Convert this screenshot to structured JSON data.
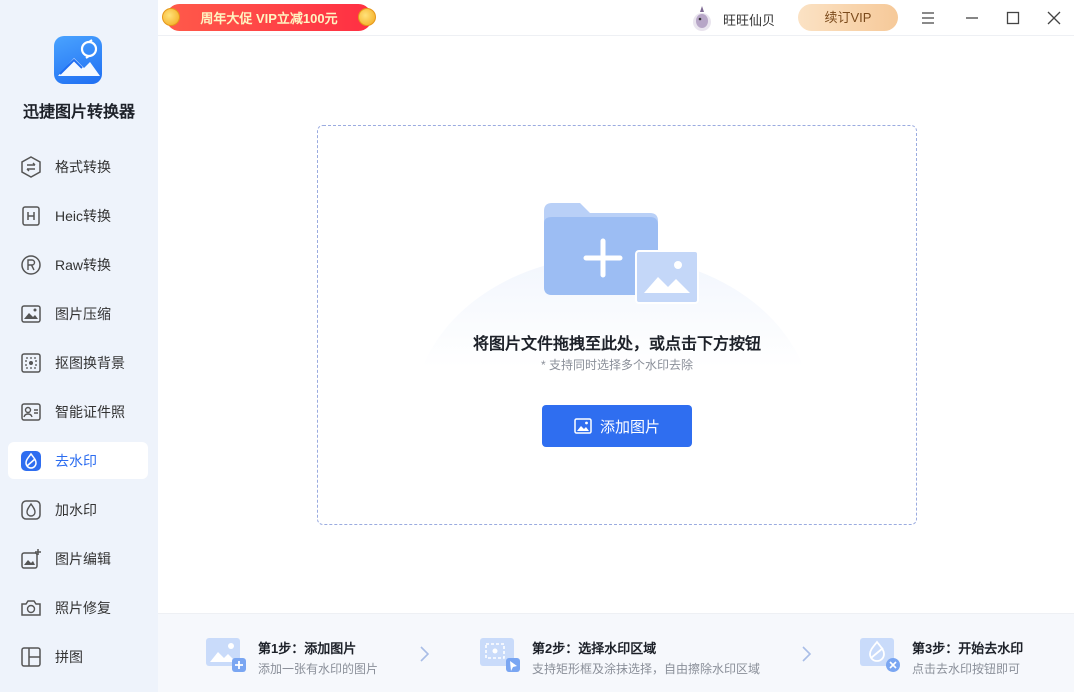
{
  "app": {
    "title": "迅捷图片转换器"
  },
  "sidebar": {
    "items": [
      {
        "label": "格式转换",
        "icon": "format-convert-icon"
      },
      {
        "label": "Heic转换",
        "icon": "heic-icon"
      },
      {
        "label": "Raw转换",
        "icon": "raw-icon"
      },
      {
        "label": "图片压缩",
        "icon": "compress-icon"
      },
      {
        "label": "抠图换背景",
        "icon": "cutout-icon"
      },
      {
        "label": "智能证件照",
        "icon": "id-photo-icon"
      },
      {
        "label": "去水印",
        "icon": "remove-watermark-icon",
        "active": true
      },
      {
        "label": "加水印",
        "icon": "add-watermark-icon"
      },
      {
        "label": "图片编辑",
        "icon": "image-edit-icon"
      },
      {
        "label": "照片修复",
        "icon": "photo-repair-icon"
      },
      {
        "label": "拼图",
        "icon": "collage-icon"
      }
    ]
  },
  "topbar": {
    "promo": "周年大促 VIP立减100元",
    "username": "旺旺仙贝",
    "vip_button": "续订VIP"
  },
  "dropzone": {
    "title": "将图片文件拖拽至此处，或点击下方按钮",
    "subtitle": "* 支持同时选择多个水印去除",
    "button": "添加图片"
  },
  "steps": [
    {
      "title": "第1步：添加图片",
      "desc": "添加一张有水印的图片"
    },
    {
      "title": "第2步：选择水印区域",
      "desc": "支持矩形框及涂抹选择，自由擦除水印区域"
    },
    {
      "title": "第3步：开始去水印",
      "desc": "点击去水印按钮即可"
    }
  ],
  "colors": {
    "accent": "#2f6ef0",
    "sidebar_bg": "#eef3fb",
    "promo": "#ff3a45"
  }
}
